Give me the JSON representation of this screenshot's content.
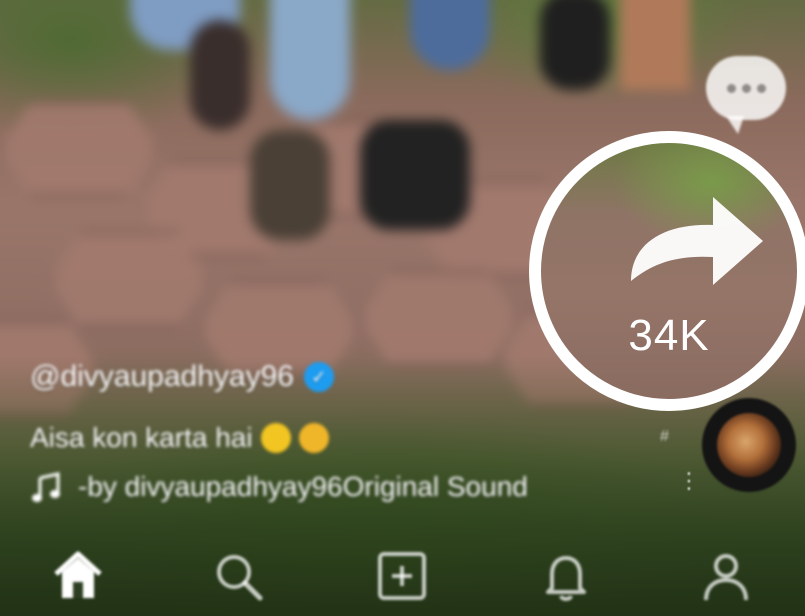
{
  "video": {
    "username": "@divyaupadhyay96",
    "caption": "Aisa kon karta hai",
    "sound": "-by divyaupadhyay96Original Sound"
  },
  "actions": {
    "share_count": "34K"
  },
  "icons": {
    "comment": "comment-bubble-icon",
    "share": "share-arrow-icon",
    "verified": "verified-badge-icon",
    "music": "music-note-icon",
    "home": "home-icon",
    "search": "search-icon",
    "add": "add-post-icon",
    "notifications": "bell-icon",
    "profile": "profile-icon"
  },
  "colors": {
    "highlight_ring": "#ffffff",
    "verified": "#1e9cf0"
  }
}
